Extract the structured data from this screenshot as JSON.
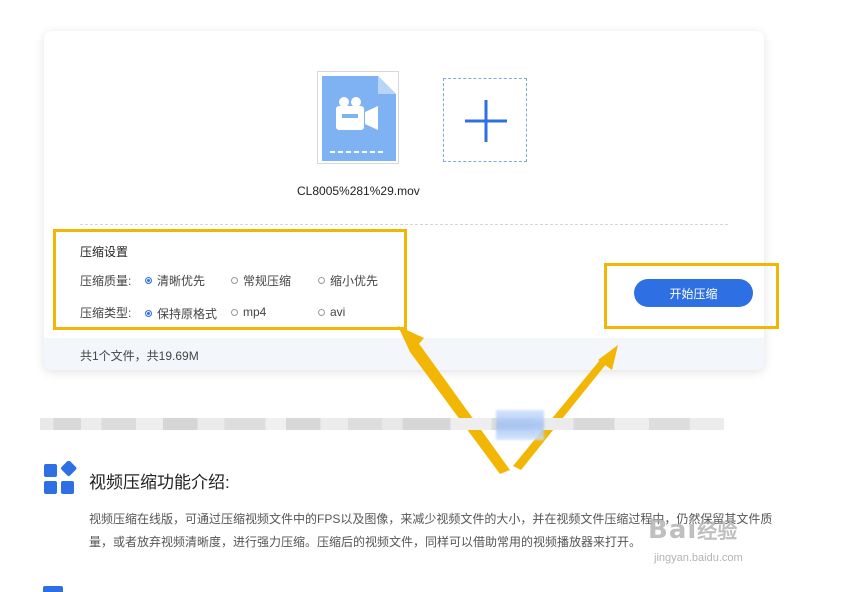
{
  "upload": {
    "file_name": "CL8005%281%29.mov"
  },
  "settings": {
    "title": "压缩设置",
    "quality_label": "压缩质量:",
    "quality_options": [
      "清晰优先",
      "常规压缩",
      "缩小优先"
    ],
    "quality_selected": "清晰优先",
    "type_label": "压缩类型:",
    "type_options": [
      "保持原格式",
      "mp4",
      "avi"
    ],
    "type_selected": "保持原格式"
  },
  "actions": {
    "start_label": "开始压缩"
  },
  "footer": {
    "summary": "共1个文件，共19.69M"
  },
  "intro": {
    "title": "视频压缩功能介绍:",
    "body": "视频压缩在线版，可通过压缩视频文件中的FPS以及图像，来减少视频文件的大小，并在视频文件压缩过程中，仍然保留其文件质量，或者放弃视频清晰度，进行强力压缩。压缩后的视频文件，同样可以借助常用的视频播放器来打开。"
  },
  "watermark": {
    "brand": "Bai",
    "brand_suffix": "经验",
    "url": "jingyan.baidu.com"
  },
  "colors": {
    "accent": "#2f6fe4",
    "highlight": "#f2b705",
    "file_icon": "#7fb2f2"
  }
}
